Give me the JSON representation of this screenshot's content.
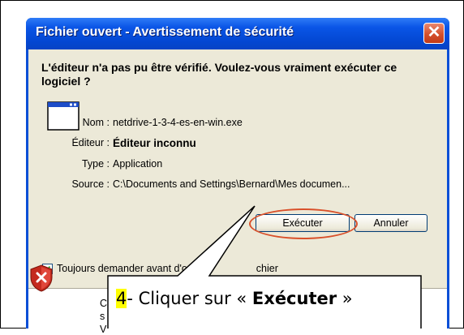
{
  "window": {
    "title": "Fichier ouvert - Avertissement de sécurité",
    "close_label": "✕"
  },
  "dialog": {
    "headline": "L'éditeur n'a pas pu être vérifié. Voulez-vous vraiment exécuter ce logiciel ?",
    "fields": {
      "name_label": "Nom :",
      "name_value": "netdrive-1-3-4-es-en-win.exe",
      "publisher_label": "Éditeur :",
      "publisher_value": "Éditeur inconnu",
      "type_label": "Type :",
      "type_value": "Application",
      "source_label": "Source :",
      "source_value": "C:\\Documents and Settings\\Bernard\\Mes documen..."
    },
    "buttons": {
      "run_label": "Exécuter",
      "cancel_label": "Annuler"
    },
    "checkbox": {
      "label_start": "Toujours demander avant d'ou",
      "label_end": "chier",
      "checked": true
    },
    "bottom_fragments": [
      "C",
      "s",
      "V"
    ]
  },
  "callout": {
    "step_number": "4",
    "text_pre": "- Cliquer sur « ",
    "text_bold": "Exécuter",
    "text_post": " »"
  },
  "colors": {
    "title_blue": "#0a55e6",
    "dialog_bg": "#ece9d8",
    "close_red": "#d5502c",
    "highlight_orange": "#d9502a",
    "step_highlight": "#ffff00"
  },
  "icons": [
    "window-app-icon",
    "close-icon",
    "check-icon",
    "shield-warning-icon"
  ]
}
